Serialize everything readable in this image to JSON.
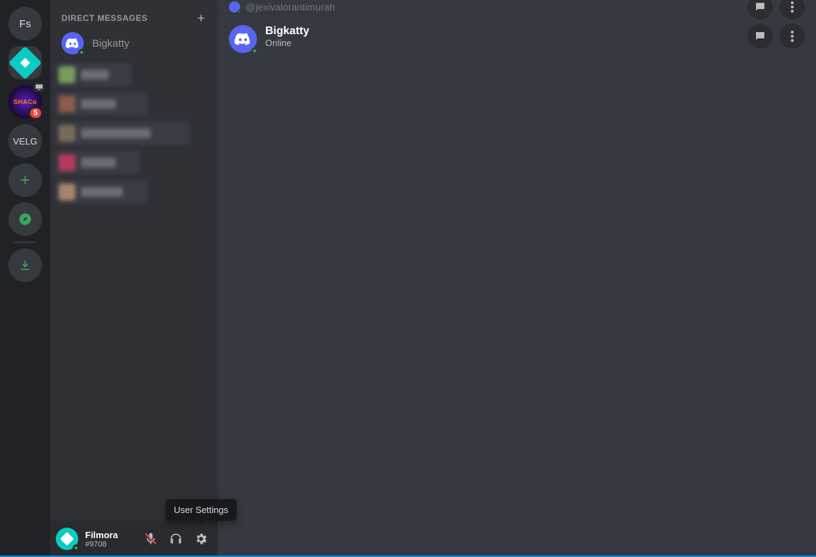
{
  "servers": {
    "home_initials": "Fs",
    "shaco_label": "SHACo",
    "shaco_badge": "5",
    "velg_label": "VELG"
  },
  "sidebar": {
    "header": "DIRECT MESSAGES",
    "dm_name": "Bigkatty"
  },
  "user_panel": {
    "name": "Filmora",
    "tag": "#9708",
    "tooltip": "User Settings"
  },
  "topbar": {
    "handle": "@jexivalorantimurah"
  },
  "profile": {
    "name": "Bigkatty",
    "status": "Online"
  }
}
